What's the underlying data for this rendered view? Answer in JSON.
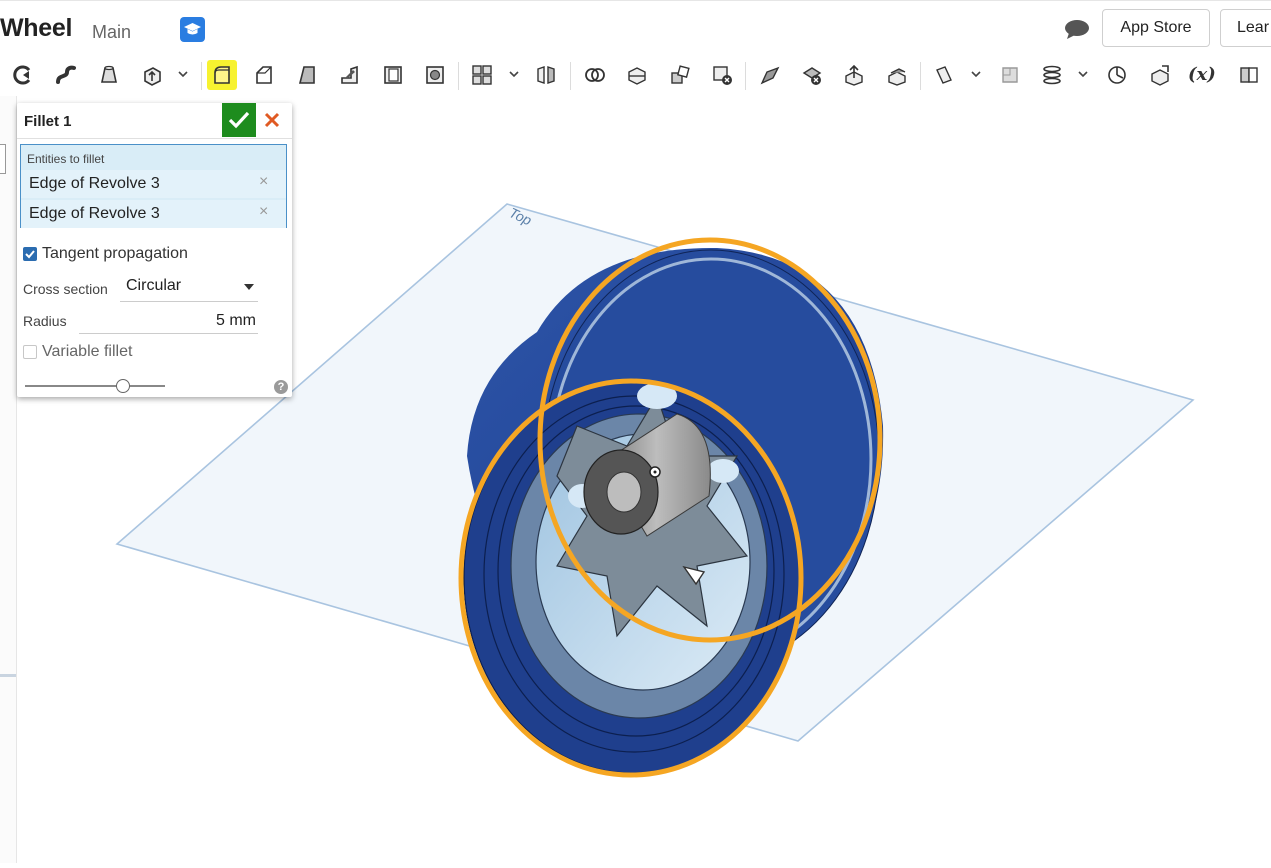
{
  "header": {
    "document_title": "Wheel",
    "branch": "Main",
    "app_store_label": "App Store",
    "learn_label": "Lear"
  },
  "fillet_panel": {
    "title": "Fillet 1",
    "entities_label": "Entities to fillet",
    "entities": [
      "Edge of Revolve 3",
      "Edge of Revolve 3"
    ],
    "tangent_propagation_label": "Tangent propagation",
    "tangent_propagation_checked": true,
    "cross_section_label": "Cross section",
    "cross_section_value": "Circular",
    "radius_label": "Radius",
    "radius_value": "5 mm",
    "variable_fillet_label": "Variable fillet",
    "variable_fillet_checked": false,
    "help_symbol": "?"
  },
  "viewport": {
    "plane_label": "Top"
  },
  "toolbar": {
    "variable_label": "(x)",
    "active_tool": "fillet-icon"
  },
  "colors": {
    "accent_blue": "#2a7de1",
    "accept_green": "#1e8c1e",
    "cancel_red": "#e05a23",
    "selection_orange": "#f5a623",
    "tire_blue": "#1e3f8a",
    "plane_fill": "#eef4fa",
    "plane_edge": "#a9c4e0"
  }
}
